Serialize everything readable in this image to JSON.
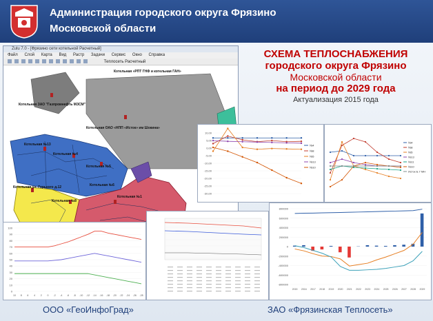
{
  "header": {
    "org_line1": "Администрация городского округа Фрязино",
    "org_line2": "Московской области"
  },
  "app": {
    "title": "Zulu 7.0 - [Фрязино сети котельной Расчетный]",
    "menu": [
      "Файл",
      "Слой",
      "Карта",
      "Вид",
      "Растр",
      "Задачи",
      "Сервис",
      "Окно",
      "Справка"
    ],
    "layer": "Теплосеть Расчетный"
  },
  "map_labels": {
    "northwest": "Котельная ЗАО \"Газпромнефть МЗСМ\"",
    "north": "Котельная ОАО «НПП «Исток» им Шокина»",
    "top_banner": "Котельная «РПТ ГНФ и котельная ГАН»",
    "no13": "Котельная №13",
    "no4": "Котельная №4",
    "no5": "Котельная №5",
    "gorky": "Котельная ул. Горького д.12",
    "no8": "Котельная №8",
    "no1": "Котельная №1",
    "no6": "Котельная №6"
  },
  "title": {
    "line1": "СХЕМА ТЕПЛОСНАБЖЕНИЯ",
    "line2": "городского округа Фрязино",
    "line3": "Московской области",
    "line4": "на период до 2029 года",
    "line5": "Актуализация 2015 года"
  },
  "footer": {
    "left": "ООО «ГеоИнфоГрад»",
    "right": "ЗАО «Фрязинская Теплосеть»"
  },
  "chart_data": [
    {
      "type": "line",
      "series": [
        {
          "name": "№4",
          "color": "#2e5fa8"
        },
        {
          "name": "№8",
          "color": "#c0392b"
        },
        {
          "name": "№5",
          "color": "#e67e22"
        },
        {
          "name": "№13",
          "color": "#8e44ad"
        },
        {
          "name": "№10",
          "color": "#d35400"
        }
      ],
      "yticks": [
        "10,00",
        "5,00",
        "0,00",
        "-5,00",
        "-10,00",
        "-15,00",
        "-20,00",
        "-25,00",
        "-30,00"
      ]
    },
    {
      "type": "line",
      "series": [
        {
          "name": "№4",
          "color": "#2e5fa8"
        },
        {
          "name": "№8",
          "color": "#c0392b"
        },
        {
          "name": "№5",
          "color": "#e67e22"
        },
        {
          "name": "№13",
          "color": "#8e44ad"
        },
        {
          "name": "№11",
          "color": "#16a085"
        },
        {
          "name": "№10",
          "color": "#d35400"
        },
        {
          "name": "Исток Б.7 МН",
          "color": "#7f8c8d"
        }
      ]
    },
    {
      "type": "line",
      "yticks": [
        "100",
        "90",
        "80",
        "70",
        "60",
        "50",
        "40",
        "30",
        "20",
        "10",
        "0"
      ],
      "categories": [
        "10",
        "8",
        "6",
        "4",
        "2",
        "0",
        "-2",
        "-4",
        "-6",
        "-8",
        "-10",
        "-12",
        "-14",
        "-16",
        "-18",
        "-20",
        "-22",
        "-24",
        "-26",
        "-28"
      ],
      "series": [
        {
          "name": "",
          "color": "#e74c3c",
          "values": [
            70,
            70,
            70,
            70,
            70,
            70,
            72,
            75,
            78,
            82,
            86,
            90,
            95,
            95,
            92,
            90,
            88,
            86,
            84,
            82
          ]
        },
        {
          "name": "",
          "color": "#6c63d9",
          "values": [
            48,
            48,
            48,
            48,
            48,
            48,
            49,
            50,
            52,
            54,
            56,
            58,
            60,
            58,
            56,
            54,
            52,
            50,
            48,
            46
          ]
        },
        {
          "name": "",
          "color": "#4caf50",
          "values": [
            28,
            28,
            28,
            28,
            28,
            28,
            28,
            28,
            28,
            28,
            28,
            28,
            26,
            24,
            22,
            20,
            18,
            16,
            14,
            12
          ]
        }
      ]
    },
    {
      "type": "bar",
      "yticks": [
        "800000",
        "600000",
        "400000",
        "200000",
        "0",
        "-200000",
        "-400000",
        "-600000",
        "-800000"
      ],
      "categories": [
        "2015",
        "2016",
        "2017",
        "2018",
        "2019",
        "2020",
        "2021",
        "2022",
        "2023",
        "2024",
        "2025",
        "2026",
        "2027",
        "2028",
        "2029"
      ],
      "values": [
        20000,
        30000,
        -90000,
        -60000,
        15000,
        -120000,
        -230000,
        5000,
        30000,
        20000,
        15000,
        30000,
        40000,
        60000,
        700000
      ],
      "series": [
        {
          "name": "",
          "color": "#2e5fa8",
          "values": [
            700000,
            705000,
            708000,
            712000,
            716000,
            720000,
            725000,
            730000,
            735000,
            740000,
            745000,
            750000,
            755000,
            760000,
            790000
          ]
        },
        {
          "name": "",
          "color": "#e67e22",
          "values": [
            -50000,
            -90000,
            -150000,
            -200000,
            -210000,
            -260000,
            -410000,
            -380000,
            -350000,
            -280000,
            -220000,
            -150000,
            -80000,
            50000,
            300000
          ]
        },
        {
          "name": "",
          "color": "#3aa0b8",
          "values": [
            20000,
            -20000,
            -80000,
            -140000,
            -220000,
            -420000,
            -500000,
            -500000,
            -490000,
            -480000,
            -460000,
            -430000,
            -400000,
            -300000,
            -100000
          ]
        }
      ]
    }
  ]
}
